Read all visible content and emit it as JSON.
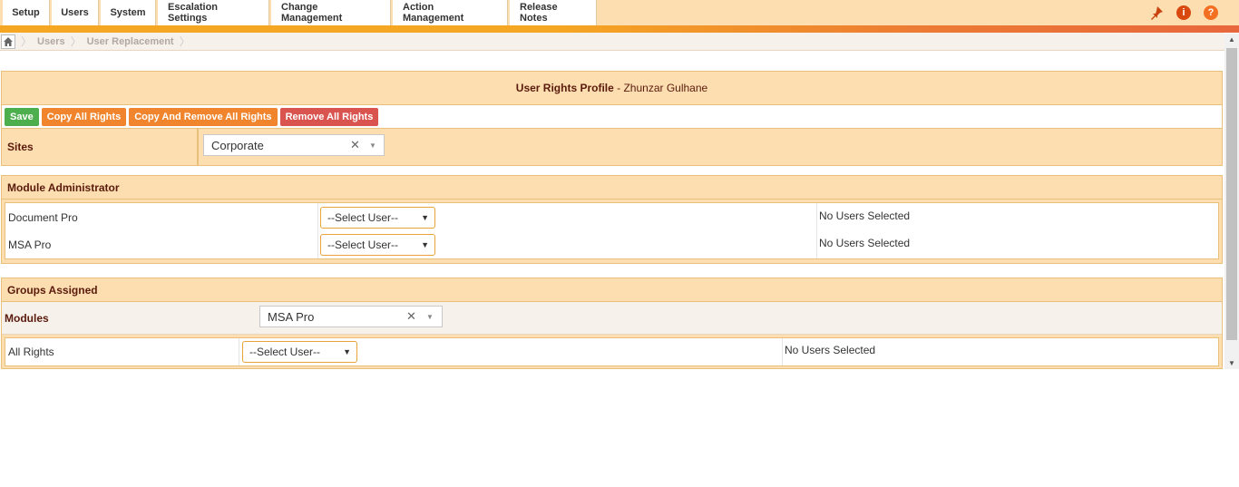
{
  "tabs": [
    "Setup",
    "Users",
    "System",
    "Escalation Settings",
    "Change Management",
    "Action Management",
    "Release Notes"
  ],
  "top_icons": [
    "pin-icon",
    "info-icon",
    "help-icon"
  ],
  "breadcrumb": {
    "home_icon": "home-icon",
    "items": [
      "Users",
      "User Replacement"
    ]
  },
  "profile": {
    "title": "User Rights Profile",
    "user": " - Zhunzar Gulhane",
    "buttons": {
      "save": "Save",
      "copy_all": "Copy All Rights",
      "copy_remove": "Copy And Remove All Rights",
      "remove_all": "Remove All Rights"
    },
    "sites_label": "Sites",
    "sites_value": "Corporate"
  },
  "module_admin": {
    "title": "Module Administrator",
    "rows": [
      {
        "module": "Document Pro",
        "select": "--Select User--",
        "status": "No Users Selected"
      },
      {
        "module": "MSA Pro",
        "select": "--Select User--",
        "status": "No Users Selected"
      }
    ]
  },
  "groups": {
    "title": "Groups Assigned",
    "modules_label": "Modules",
    "modules_value": "MSA Pro",
    "rows": [
      {
        "module": "All Rights",
        "select": "--Select User--",
        "status": "No Users Selected"
      }
    ]
  },
  "colors": {
    "panel_bg": "#fddeb0",
    "accent": "#f5a623",
    "save": "#4cae4c",
    "copy": "#f0852d",
    "remove": "#d9534f",
    "heading_text": "#5a1a0c"
  }
}
